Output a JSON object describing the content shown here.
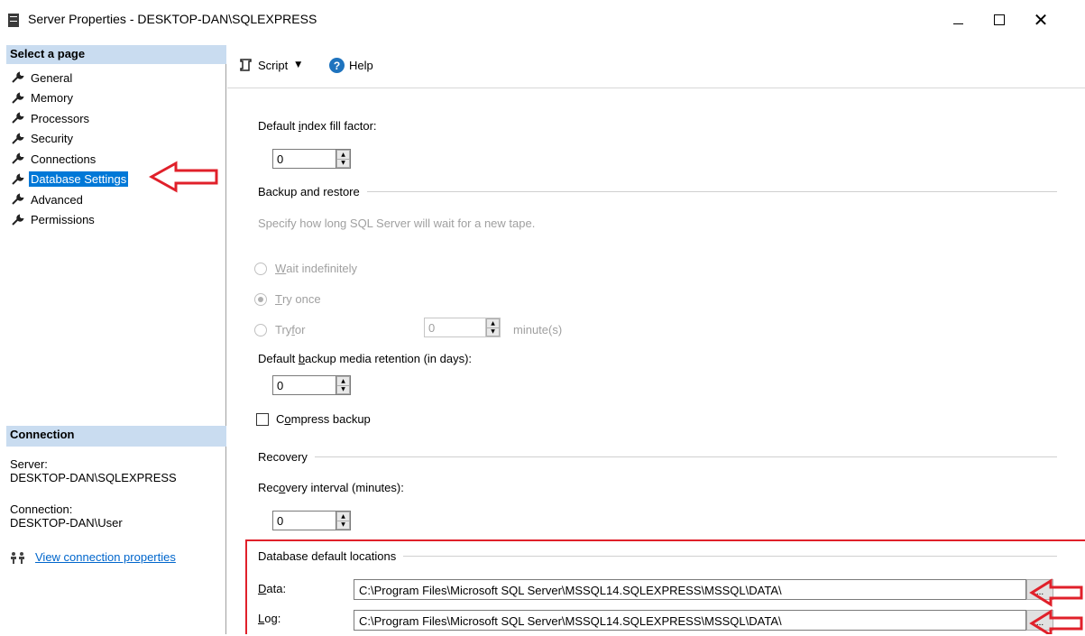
{
  "window": {
    "title": "Server Properties - DESKTOP-DAN\\SQLEXPRESS",
    "icon": "server-app-icon",
    "controls": {
      "minimize": "minimize-icon",
      "maximize": "maximize-icon",
      "close": "✕"
    }
  },
  "sidebar": {
    "select_header": "Select a page",
    "items": [
      {
        "label": "General",
        "icon": "wrench-icon"
      },
      {
        "label": "Memory",
        "icon": "wrench-icon"
      },
      {
        "label": "Processors",
        "icon": "wrench-icon"
      },
      {
        "label": "Security",
        "icon": "wrench-icon"
      },
      {
        "label": "Connections",
        "icon": "wrench-icon"
      },
      {
        "label": "Database Settings",
        "icon": "wrench-icon",
        "selected": true
      },
      {
        "label": "Advanced",
        "icon": "wrench-icon"
      },
      {
        "label": "Permissions",
        "icon": "wrench-icon"
      }
    ],
    "connection_header": "Connection",
    "server_label": "Server:",
    "server_value": "DESKTOP-DAN\\SQLEXPRESS",
    "connection_label": "Connection:",
    "connection_value": "DESKTOP-DAN\\User",
    "view_link": "View connection properties"
  },
  "toolbar": {
    "script_label": "Script",
    "help_label": "Help",
    "help_icon_glyph": "?"
  },
  "settings": {
    "fill_factor_label_pre": "Default ",
    "fill_factor_label_u": "i",
    "fill_factor_label_post": "ndex fill factor:",
    "fill_factor_value": "0",
    "backup_group_title": "Backup and restore",
    "backup_description": "Specify how long SQL Server will wait for a new tape.",
    "radio_wait_pre": "",
    "radio_wait_u": "W",
    "radio_wait_post": "ait indefinitely",
    "radio_try_once_pre": "",
    "radio_try_once_u": "T",
    "radio_try_once_post": "ry once",
    "radio_try_for_pre": "Try ",
    "radio_try_for_u": "f",
    "radio_try_for_post": "or",
    "try_for_value": "0",
    "try_for_unit": "minute(s)",
    "retention_label_pre": "Default ",
    "retention_label_u": "b",
    "retention_label_post": "ackup media retention (in days):",
    "retention_value": "0",
    "compress_pre": "C",
    "compress_u": "o",
    "compress_post": "mpress backup",
    "recovery_group_title": "Recovery",
    "recovery_label_pre": "Rec",
    "recovery_label_u": "o",
    "recovery_label_post": "very interval (minutes):",
    "recovery_value": "0",
    "locations_group_title": "Database default locations",
    "data_label_u": "D",
    "data_label_post": "ata:",
    "data_path": "C:\\Program Files\\Microsoft SQL Server\\MSSQL14.SQLEXPRESS\\MSSQL\\DATA\\",
    "log_label_u": "L",
    "log_label_post": "og:",
    "log_path": "C:\\Program Files\\Microsoft SQL Server\\MSSQL14.SQLEXPRESS\\MSSQL\\DATA\\",
    "browse_label": "..."
  },
  "annotations": {
    "color": "#e0202a"
  }
}
